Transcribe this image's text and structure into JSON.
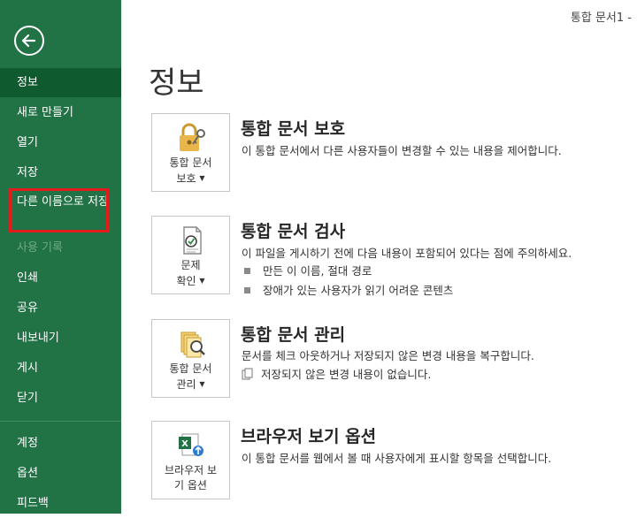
{
  "window": {
    "title": "통합 문서1 -"
  },
  "sidebar": {
    "items": [
      {
        "label": "정보"
      },
      {
        "label": "새로 만들기"
      },
      {
        "label": "열기"
      },
      {
        "label": "저장"
      },
      {
        "label": "다른 이름으로 저장"
      },
      {
        "label": "사용 기록"
      },
      {
        "label": "인쇄"
      },
      {
        "label": "공유"
      },
      {
        "label": "내보내기"
      },
      {
        "label": "게시"
      },
      {
        "label": "닫기"
      },
      {
        "label": "계정"
      },
      {
        "label": "옵션"
      },
      {
        "label": "피드백"
      }
    ]
  },
  "main": {
    "title": "정보",
    "sections": [
      {
        "button_line1": "통합 문서",
        "button_line2": "보호",
        "title": "통합 문서 보호",
        "description": "이 통합 문서에서 다른 사용자들이 변경할 수 있는 내용을 제어합니다."
      },
      {
        "button_line1": "문제",
        "button_line2": "확인",
        "title": "통합 문서 검사",
        "description": "이 파일을 게시하기 전에 다음 내용이 포함되어 있다는 점에 주의하세요.",
        "bullets": [
          "만든 이 이름, 절대 경로",
          "장애가 있는 사용자가 읽기 어려운 콘텐츠"
        ]
      },
      {
        "button_line1": "통합 문서",
        "button_line2": "관리",
        "title": "통합 문서 관리",
        "description": "문서를 체크 아웃하거나 저장되지 않은 변경 내용을 복구합니다.",
        "note": "저장되지 않은 변경 내용이 없습니다."
      },
      {
        "button_line1": "브라우저 보",
        "button_line2": "기 옵션",
        "title": "브라우저 보기 옵션",
        "description": "이 통합 문서를 웹에서 볼 때 사용자에게 표시할 항목을 선택합니다."
      }
    ]
  },
  "colors": {
    "sidebar": "#217346",
    "active_item": "#0f5a2e",
    "highlight": "#e21b1b"
  }
}
